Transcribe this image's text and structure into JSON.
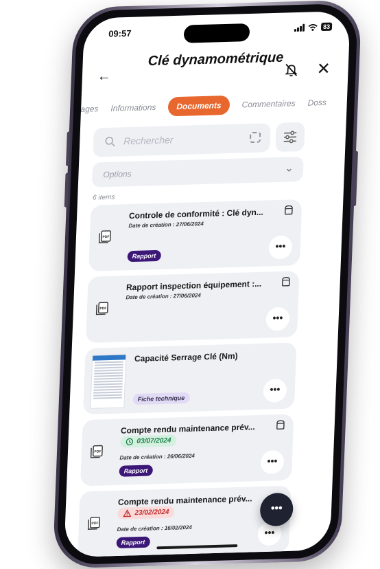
{
  "status": {
    "time": "09:57",
    "battery": "83"
  },
  "header": {
    "title": "Clé dynamométrique"
  },
  "tabs": [
    {
      "label": "mblages"
    },
    {
      "label": "Informations"
    },
    {
      "label": "Documents"
    },
    {
      "label": "Commentaires"
    },
    {
      "label": "Doss"
    }
  ],
  "search": {
    "placeholder": "Rechercher"
  },
  "options": {
    "label": "Options"
  },
  "list": {
    "count": "6 items",
    "items": [
      {
        "title": "Controle de conformité  : Clé dyn...",
        "date": "Date de création : 27/06/2024",
        "tag": "Rapport"
      },
      {
        "title": "Rapport inspection équipement :...",
        "date": "Date de création : 27/06/2024"
      },
      {
        "title": "Capacité Serrage Clé (Nm)",
        "tag": "Fiche technique"
      },
      {
        "title": "Compte rendu maintenance prév...",
        "status_date": "03/07/2024",
        "date": "Date de création : 26/06/2024",
        "tag": "Rapport"
      },
      {
        "title": "Compte rendu maintenance prév...",
        "status_date": "23/02/2024",
        "date": "Date de création : 16/02/2024",
        "tag": "Rapport"
      }
    ]
  },
  "icons": {
    "more": "more-horizontal-icon",
    "pdf": "pdf-file-icon",
    "archive": "archive-icon",
    "search": "search-icon",
    "scan": "scan-icon",
    "filter": "sliders-icon",
    "bell": "bell-off-icon"
  },
  "colors": {
    "accent": "#e8672e",
    "tag_purple": "#3c1777",
    "tag_lavender": "#e2dbf5",
    "status_green": "#188046",
    "status_red": "#c42b2b",
    "card_bg": "#eef0f4"
  }
}
